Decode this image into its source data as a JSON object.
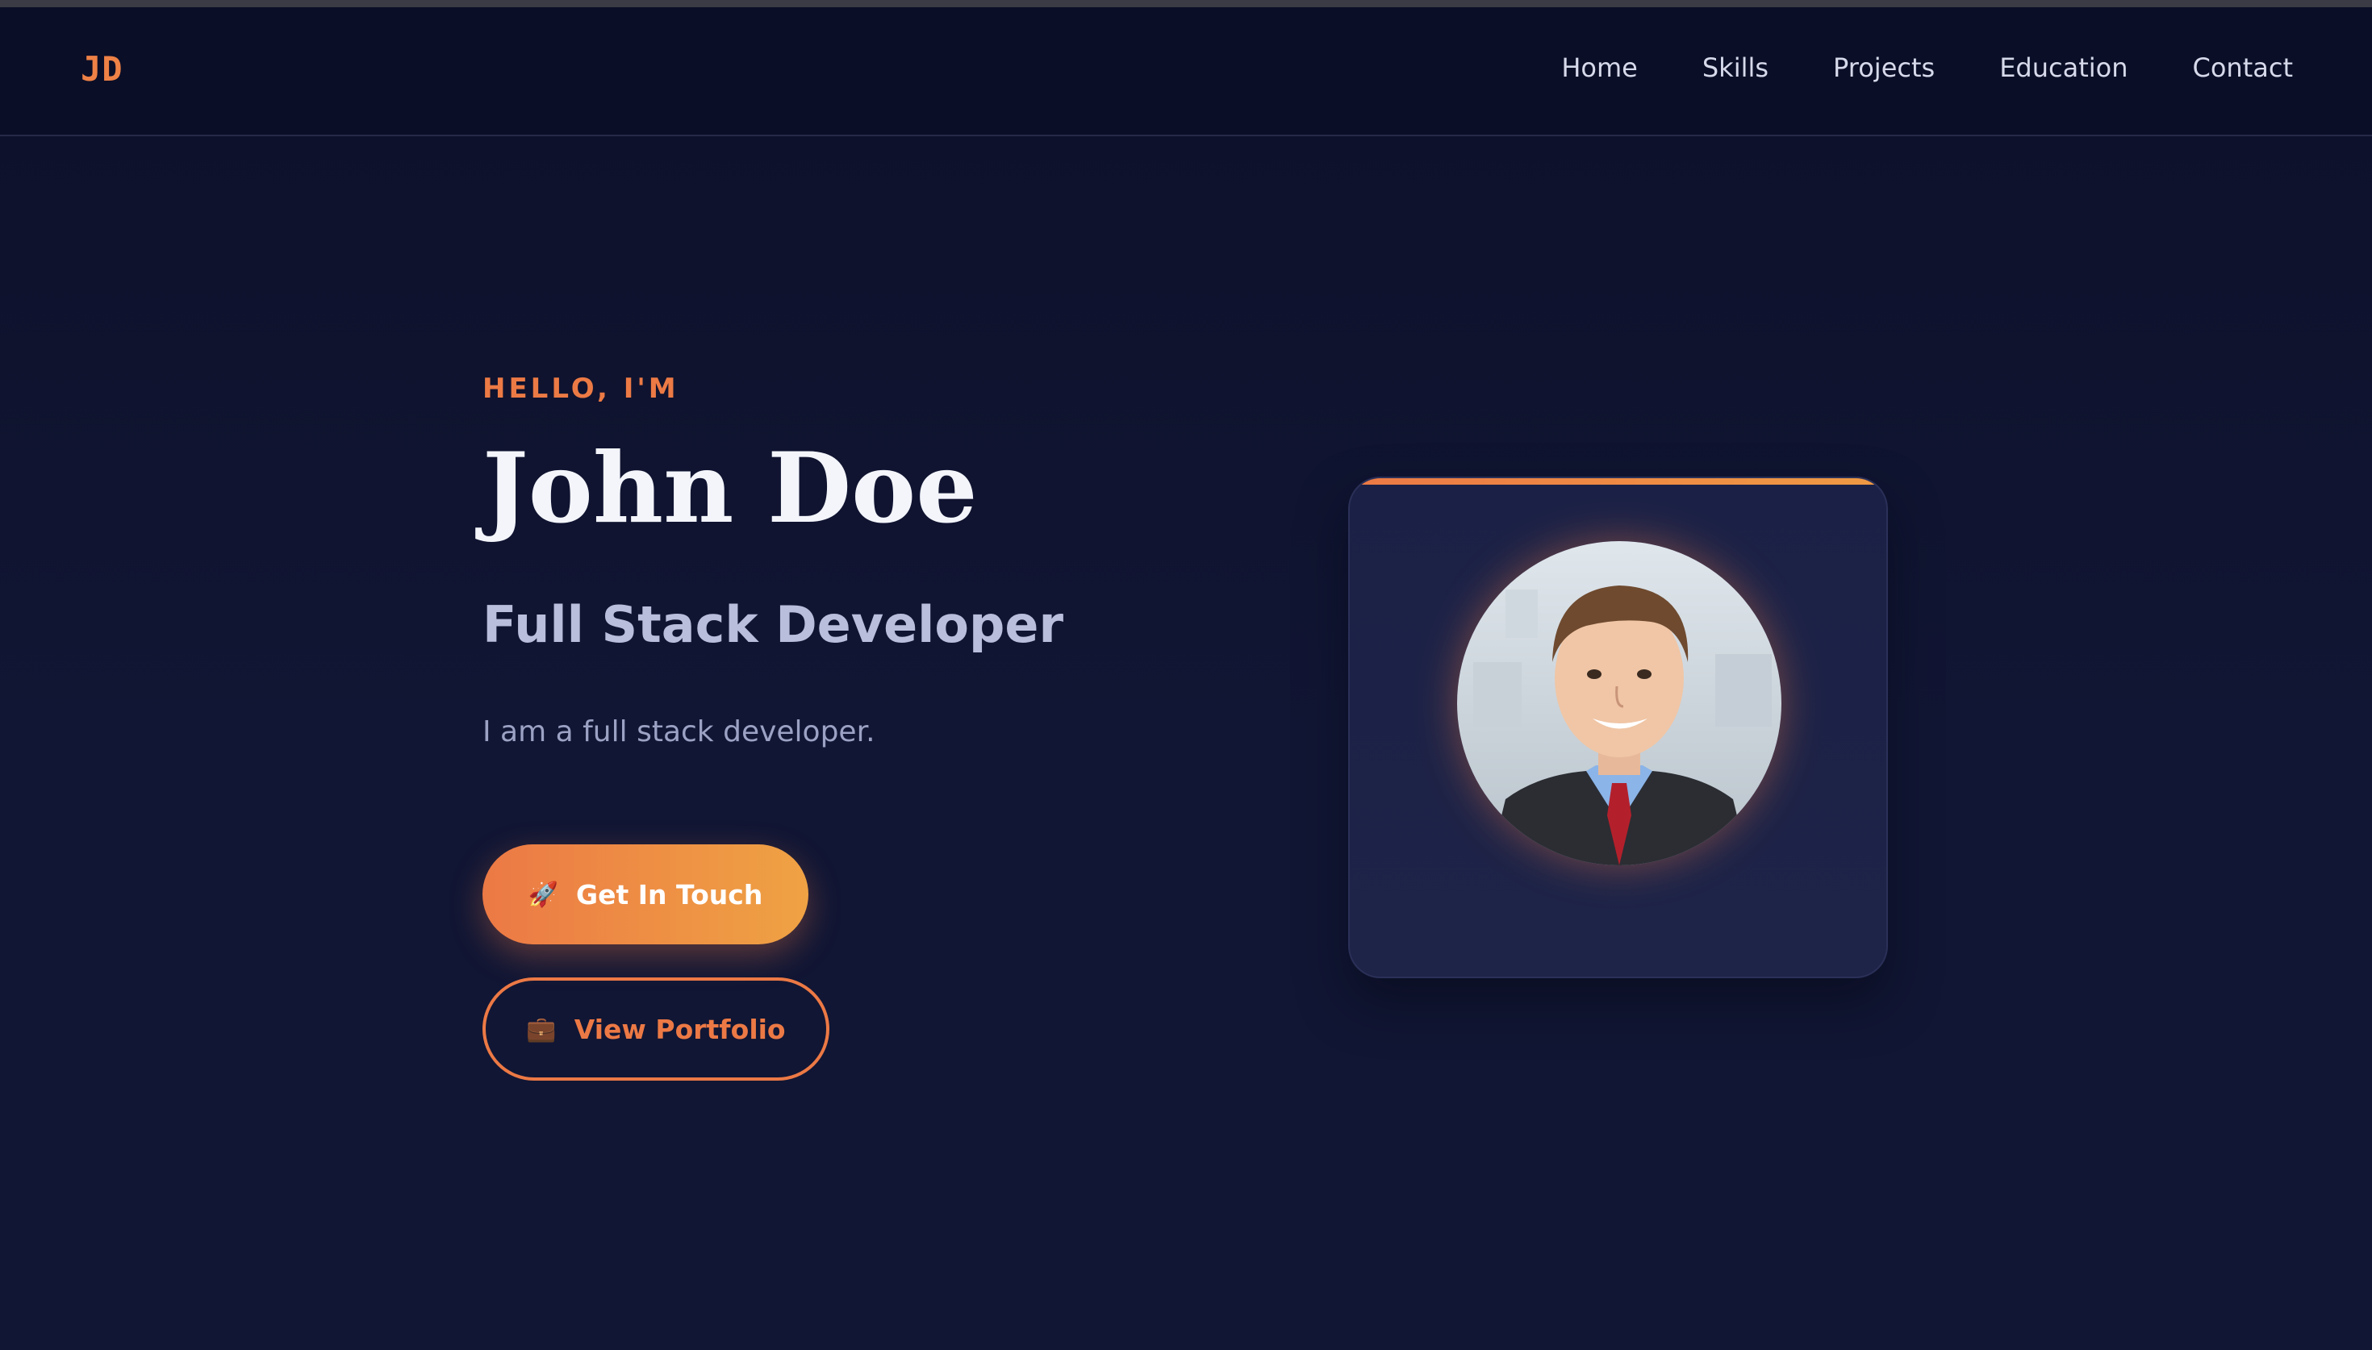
{
  "logo": "JD",
  "nav": {
    "items": [
      "Home",
      "Skills",
      "Projects",
      "Education",
      "Contact"
    ]
  },
  "hero": {
    "greeting": "HELLO, I'M",
    "name": "John Doe",
    "role": "Full Stack Developer",
    "intro": "I am a full stack developer.",
    "primary_button": {
      "icon": "rocket-icon",
      "glyph": "🚀",
      "label": "Get In Touch"
    },
    "secondary_button": {
      "icon": "briefcase-icon",
      "glyph": "💼",
      "label": "View Portfolio"
    }
  },
  "profile": {
    "image": "profile-photo"
  },
  "colors": {
    "accent": "#ec7945",
    "accent_end": "#efa244",
    "background": "#0f1330",
    "nav_bg": "#0b0e27",
    "card_bg": "#1c2247"
  }
}
